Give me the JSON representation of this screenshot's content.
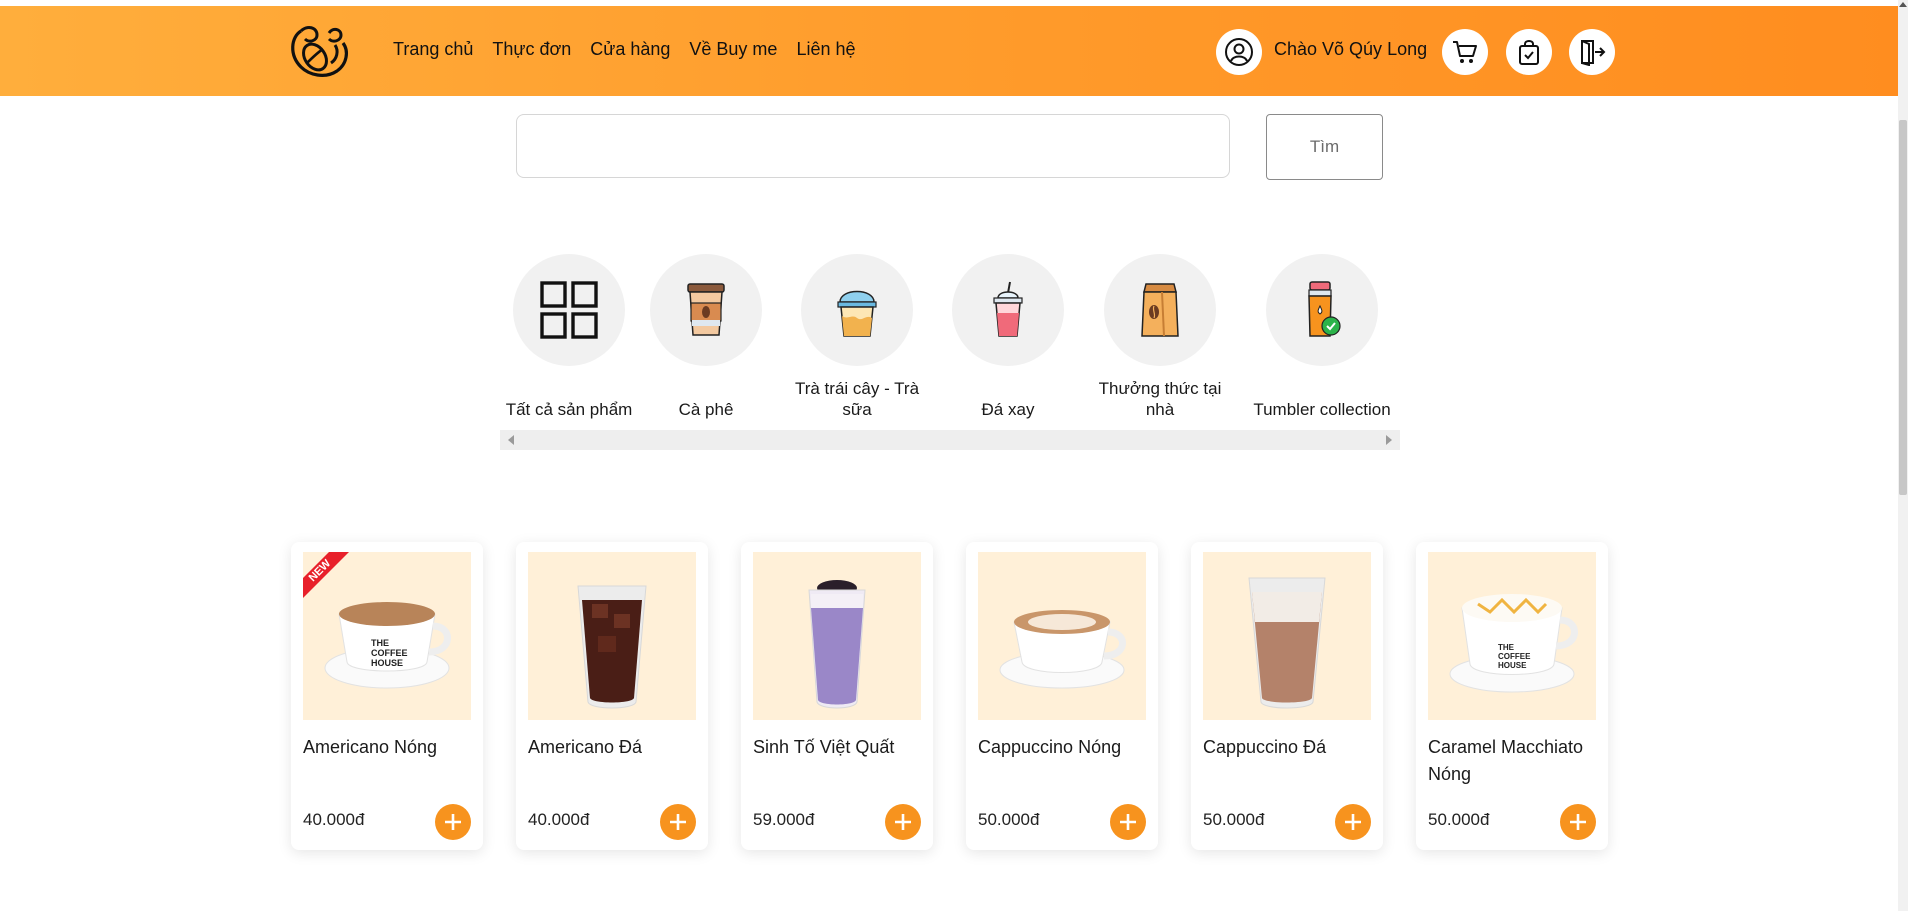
{
  "header": {
    "logo_icon": "coffee-bean-logo-icon",
    "nav": [
      "Trang chủ",
      "Thực đơn",
      "Cửa hàng",
      "Về Buy me",
      "Liên hệ"
    ],
    "greeting": "Chào Võ Qúy Long",
    "icons": [
      "user-icon",
      "cart-icon",
      "shopping-bag-icon",
      "logout-icon"
    ]
  },
  "search": {
    "value": "",
    "placeholder": "",
    "button_label": "Tìm"
  },
  "categories": [
    {
      "label": "Tất cả sản phẩm",
      "icon": "grid-icon"
    },
    {
      "label": "Cà phê",
      "icon": "coffee-cup-icon"
    },
    {
      "label": "Trà trái cây - Trà sữa",
      "icon": "milk-tea-icon"
    },
    {
      "label": "Đá xay",
      "icon": "frappe-icon"
    },
    {
      "label": "Thưởng thức tại nhà",
      "icon": "coffee-bag-icon"
    },
    {
      "label": "Tumbler collection",
      "icon": "tumbler-icon"
    }
  ],
  "products": [
    {
      "name": "Americano Nóng",
      "price": "40.000đ",
      "badge": "NEW"
    },
    {
      "name": "Americano Đá",
      "price": "40.000đ"
    },
    {
      "name": "Sinh Tố Việt Quất",
      "price": "59.000đ"
    },
    {
      "name": "Cappuccino Nóng",
      "price": "50.000đ"
    },
    {
      "name": "Cappuccino Đá",
      "price": "50.000đ"
    },
    {
      "name": "Caramel Macchiato Nóng",
      "price": "50.000đ"
    }
  ],
  "colors": {
    "accent": "#f7931e",
    "header_start": "#ffae3c",
    "header_end": "#ff8d1f",
    "product_bg": "#fff0d8",
    "category_bg": "#f1f1f1"
  }
}
